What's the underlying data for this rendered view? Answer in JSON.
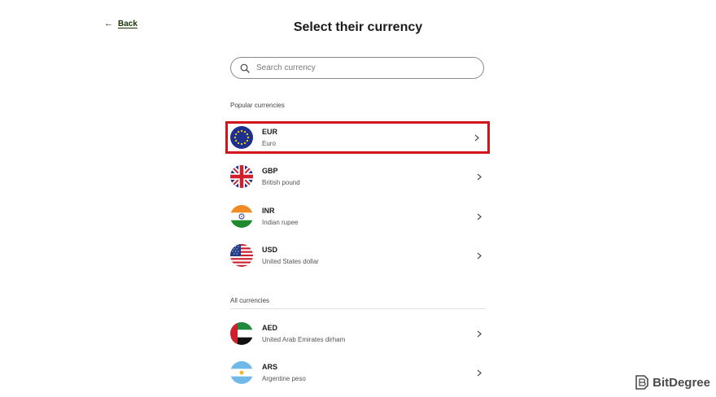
{
  "header": {
    "back_label": "Back",
    "title": "Select their currency"
  },
  "search": {
    "placeholder": "Search currency"
  },
  "sections": {
    "popular_label": "Popular currencies",
    "all_label": "All currencies"
  },
  "popular": [
    {
      "code": "EUR",
      "name": "Euro",
      "flag": "eu-flag-icon"
    },
    {
      "code": "GBP",
      "name": "British pound",
      "flag": "uk-flag-icon"
    },
    {
      "code": "INR",
      "name": "Indian rupee",
      "flag": "india-flag-icon"
    },
    {
      "code": "USD",
      "name": "United States dollar",
      "flag": "us-flag-icon"
    }
  ],
  "all": [
    {
      "code": "AED",
      "name": "United Arab Emirates dirham",
      "flag": "uae-flag-icon"
    },
    {
      "code": "ARS",
      "name": "Argentine peso",
      "flag": "argentina-flag-icon"
    }
  ],
  "watermark": {
    "brand": "BitDegree"
  },
  "colors": {
    "accent": "#163300",
    "highlight": "#d4141b"
  }
}
